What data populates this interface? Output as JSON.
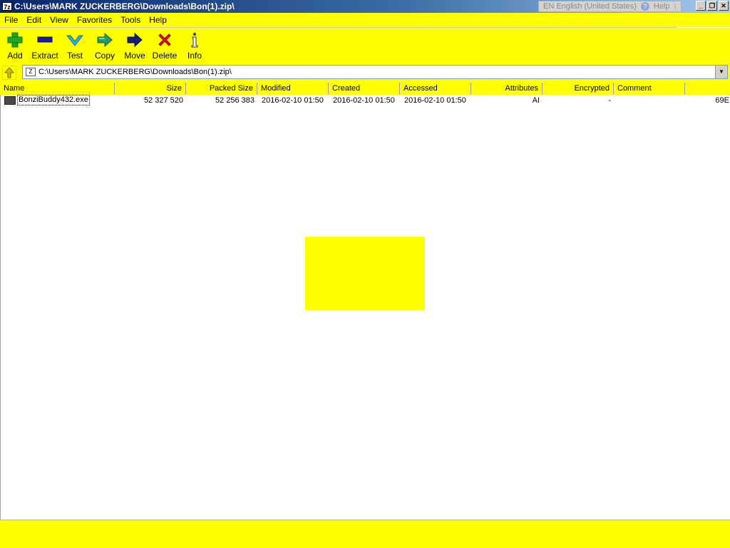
{
  "window": {
    "app_icon": "7z",
    "title": "C:\\Users\\MARK ZUCKERBERG\\Downloads\\Bon(1).zip\\",
    "language": "EN English (United States)",
    "help": "Help",
    "controls": {
      "minimize_icon": "minimize-icon",
      "restore_icon": "restore-icon",
      "close_icon": "close-icon"
    }
  },
  "menu": [
    "File",
    "Edit",
    "View",
    "Favorites",
    "Tools",
    "Help"
  ],
  "toolbar": [
    {
      "label": "Add",
      "icon": "plus-icon",
      "color": "#1fa81f"
    },
    {
      "label": "Extract",
      "icon": "minus-icon",
      "color": "#1a1a9a"
    },
    {
      "label": "Test",
      "icon": "check-icon",
      "color": "#29b6d6"
    },
    {
      "label": "Copy",
      "icon": "copy-arrow-icon",
      "color": "#2a9a6a"
    },
    {
      "label": "Move",
      "icon": "move-arrow-icon",
      "color": "#1a1a7a"
    },
    {
      "label": "Delete",
      "icon": "delete-x-icon",
      "color": "#e01010"
    },
    {
      "label": "Info",
      "icon": "info-icon",
      "color": "#333333"
    }
  ],
  "address": {
    "path": "C:\\Users\\MARK ZUCKERBERG\\Downloads\\Bon(1).zip\\",
    "path_icon": "Z"
  },
  "columns": [
    "Name",
    "Size",
    "Packed Size",
    "Modified",
    "Created",
    "Accessed",
    "Attributes",
    "Encrypted",
    "Comment"
  ],
  "files": [
    {
      "name": "BonziBuddy432.exe",
      "size": "52 327 520",
      "packed_size": "52 256 383",
      "modified": "2016-02-10 01:50",
      "created": "2016-02-10 01:50",
      "accessed": "2016-02-10 01:50",
      "attributes": "AI",
      "encrypted": "-",
      "comment": "",
      "trailing": "69E"
    }
  ],
  "colors": {
    "highlight": "#ffff00",
    "titlebar": "#0a246a"
  }
}
